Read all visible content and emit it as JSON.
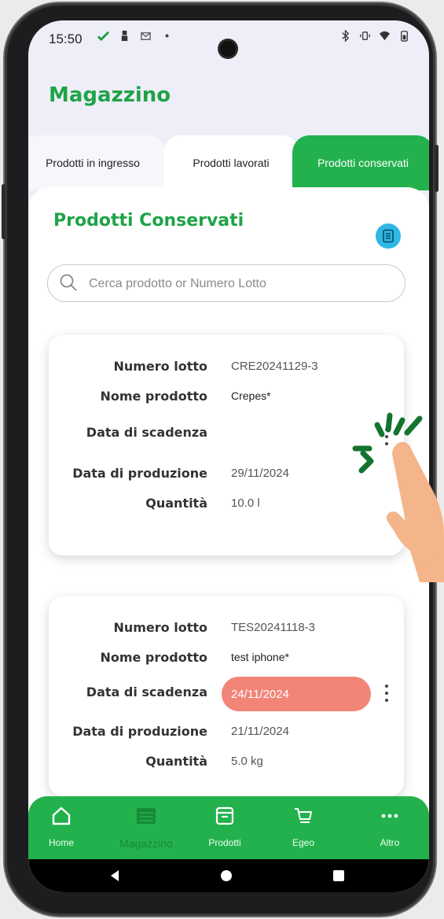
{
  "status": {
    "time": "15:50"
  },
  "app": {
    "title": "Magazzino"
  },
  "tabs": [
    {
      "label": "Prodotti in ingresso",
      "active": false
    },
    {
      "label": "Prodotti lavorati",
      "active": false
    },
    {
      "label": "Prodotti conservati",
      "active": true
    }
  ],
  "section": {
    "title": "Prodotti Conservati",
    "list_icon": "list-doc-icon"
  },
  "search": {
    "placeholder": "Cerca prodotto or Numero Lotto",
    "value": ""
  },
  "field_labels": {
    "lot": "Numero lotto",
    "name": "Nome prodotto",
    "expiry": "Data di scadenza",
    "production": "Data di produzione",
    "qty": "Quantità"
  },
  "products": [
    {
      "lot": "CRE20241129-3",
      "name": "Crepes*",
      "expiry": "",
      "production": "29/11/2024",
      "qty": "10.0 l",
      "expired": false
    },
    {
      "lot": "TES20241118-3",
      "name": "test iphone*",
      "expiry": "24/11/2024",
      "production": "21/11/2024",
      "qty": "5.0 kg",
      "expired": true
    }
  ],
  "bottom_nav": [
    {
      "label": "Home",
      "icon": "home-icon",
      "active": false
    },
    {
      "label": "Magazzino",
      "icon": "warehouse-icon",
      "active": true
    },
    {
      "label": "Prodotti",
      "icon": "box-icon",
      "active": false
    },
    {
      "label": "Egeo",
      "icon": "cart-icon",
      "active": false
    },
    {
      "label": "Altro",
      "icon": "more-icon",
      "active": false
    }
  ],
  "colors": {
    "brand_green": "#23b14d",
    "title_green": "#1fa347",
    "expired_red": "#f38478",
    "accent_blue": "#2fb7e5"
  }
}
